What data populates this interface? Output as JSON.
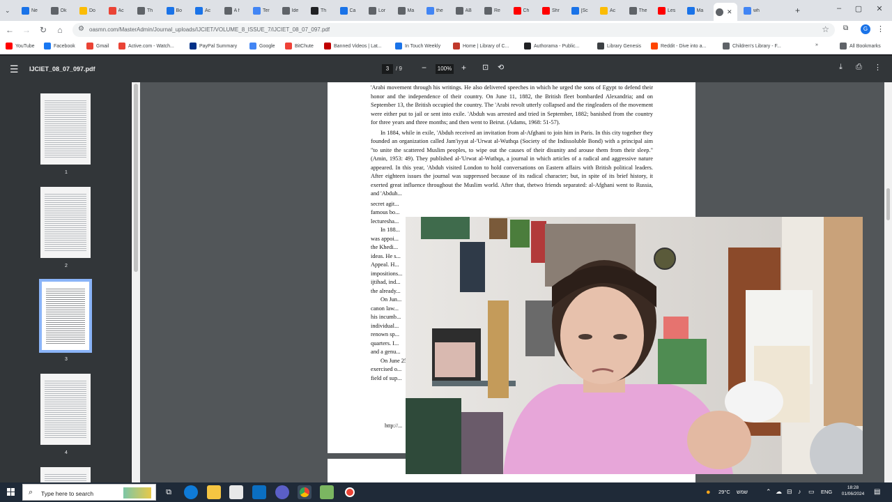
{
  "browser": {
    "tabs": [
      {
        "favicon_color": "#1a73e8",
        "title": "Ne",
        "icon": "doc-icon"
      },
      {
        "favicon_color": "#5f6368",
        "title": "Ok",
        "icon": "doc-icon"
      },
      {
        "favicon_color": "#fbbc04",
        "title": "Do",
        "icon": "bulb-icon"
      },
      {
        "favicon_color": "#ea4335",
        "title": "Ac",
        "icon": "circle-icon"
      },
      {
        "favicon_color": "#5f6368",
        "title": "Th",
        "icon": "doc-icon"
      },
      {
        "favicon_color": "#1a73e8",
        "title": "Bo",
        "icon": "doc-icon"
      },
      {
        "favicon_color": "#1a73e8",
        "title": "Ac",
        "icon": "doc-icon"
      },
      {
        "favicon_color": "#5f6368",
        "title": "A f",
        "icon": "doc-icon"
      },
      {
        "favicon_color": "#4285f4",
        "title": "Ter",
        "icon": "google-icon"
      },
      {
        "favicon_color": "#5f6368",
        "title": "Ide",
        "icon": "doc-icon"
      },
      {
        "favicon_color": "#202124",
        "title": "Th",
        "icon": "tv-icon"
      },
      {
        "favicon_color": "#1a73e8",
        "title": "Ca",
        "icon": "flag-icon"
      },
      {
        "favicon_color": "#5f6368",
        "title": "Lor",
        "icon": "wiki-icon"
      },
      {
        "favicon_color": "#5f6368",
        "title": "Ma",
        "icon": "wiki-icon"
      },
      {
        "favicon_color": "#4285f4",
        "title": "the",
        "icon": "google-icon"
      },
      {
        "favicon_color": "#5f6368",
        "title": "AB",
        "icon": "doc-icon"
      },
      {
        "favicon_color": "#5f6368",
        "title": "Re",
        "icon": "doc-icon"
      },
      {
        "favicon_color": "#ff0000",
        "title": "Ch",
        "icon": "youtube-icon"
      },
      {
        "favicon_color": "#ff0000",
        "title": "Shr",
        "icon": "youtube-icon"
      },
      {
        "favicon_color": "#1a73e8",
        "title": "[Sc",
        "icon": "edit-icon"
      },
      {
        "favicon_color": "#fbbc04",
        "title": "Ac",
        "icon": "doc-icon"
      },
      {
        "favicon_color": "#5f6368",
        "title": "The",
        "icon": "doc-icon"
      },
      {
        "favicon_color": "#ff0000",
        "title": "Les",
        "icon": "youtube-icon"
      },
      {
        "favicon_color": "#1a73e8",
        "title": "Ma",
        "icon": "doc-icon"
      }
    ],
    "active_tab": {
      "favicon_color": "#5f6368",
      "icon": "globe-icon"
    },
    "last_tab": {
      "favicon_color": "#4285f4",
      "title": "wh",
      "icon": "google-icon"
    },
    "url": "oasmn.com/MasterAdmin/Journal_uploads/IJCIET/VOLUME_8_ISSUE_7/IJCIET_08_07_097.pdf",
    "bookmarks": [
      {
        "label": "YouTube",
        "color": "#ff0000",
        "icon": "youtube-icon"
      },
      {
        "label": "Facebook",
        "color": "#1877f2",
        "icon": "facebook-icon"
      },
      {
        "label": "Gmail",
        "color": "#ea4335",
        "icon": "gmail-icon"
      },
      {
        "label": "Active.com - Watch...",
        "color": "#ea4335",
        "icon": "circle-icon"
      },
      {
        "label": "PayPal Summary",
        "color": "#003087",
        "icon": "paypal-icon"
      },
      {
        "label": "Google",
        "color": "#4285f4",
        "icon": "google-icon"
      },
      {
        "label": "BitChute",
        "color": "#ef4137",
        "icon": "bitchute-icon"
      },
      {
        "label": "Banned Videos | Lat...",
        "color": "#c00000",
        "icon": "banned-icon"
      },
      {
        "label": "In Touch Weekly",
        "color": "#1a73e8",
        "icon": "magazine-icon"
      },
      {
        "label": "Home | Library of C...",
        "color": "#c0392b",
        "icon": "library-icon"
      },
      {
        "label": "Authorama - Public...",
        "color": "#202124",
        "icon": "book-icon"
      },
      {
        "label": "Library Genesis",
        "color": "#3c4043",
        "icon": "pen-icon"
      },
      {
        "label": "Reddit - Dive into a...",
        "color": "#ff4500",
        "icon": "reddit-icon"
      },
      {
        "label": "Children's Library - F...",
        "color": "#5f6368",
        "icon": "doc-icon"
      }
    ],
    "all_bookmarks": "All Bookmarks"
  },
  "pdf": {
    "filename": "IJCIET_08_07_097.pdf",
    "current_page": "3",
    "page_total": "/ 9",
    "zoom": "100%",
    "thumbnails": [
      "1",
      "2",
      "3",
      "4"
    ],
    "paragraphs": [
      "'Arabi movement through his writings. He also delivered speeches in which he urged the sons of Egypt to defend their honor and the independence of their country. On June 11, 1882, the British fleet bombarded Alexandria; and on September 13, the British occupied the country. The 'Arabi revolt utterly collapsed and the ringleaders of the movement were either put to jail or sent into exile. 'Abduh was arrested and tried in September, 1882; banished from the country for three years and three months; and then went to Beirut. (Adams, 1968: 51-57).",
      "In 1884, while in exile, 'Abduh received an invitation from al-Afghani to join him in Paris. In this city together they founded an organization called Jam'iyyat al-'Urwat al-Wuthqa (Society of the Indissoluble Bond) with a principal aim \"to unite the scattered Muslim peoples, to wipe out the causes of their disunity and arouse them from their sleep.\" (Amin, 1953: 49). They published al-'Urwat al-Wuthqa, a journal in which articles of a radical and aggressive nature appeared. In this year, 'Abduh visited London to hold conversations on Eastern affairs with British political leaders. After eighteen issues the journal was suppressed because of its radical character; but, in spite of its brief history, it exerted great influence throughout the Muslim world. After that, thetwo friends separated: al-Afghani went to Russia, and 'Abduh...",
      "secret agit...",
      "famous bo...",
      "lecturesha...",
      "In 188...",
      "was appoi...",
      "the Khedi...",
      "ideas. He s...",
      "Appeal. H...",
      "impositions...",
      "ijtihad, ind...",
      "the already...",
      "On Jun...",
      "canon law...",
      "his incumb...",
      "individual...",
      "renown sp...",
      "quarters. I...",
      "and a genu...",
      "On June 25...",
      "exercised o...",
      "field of sup..."
    ],
    "footer": "http://..."
  },
  "taskbar": {
    "search_placeholder": "Type here to search",
    "weather": "29°C",
    "weather_label": "שמש",
    "lang": "ENG",
    "time": "18:28",
    "date": "01/06/2024"
  }
}
